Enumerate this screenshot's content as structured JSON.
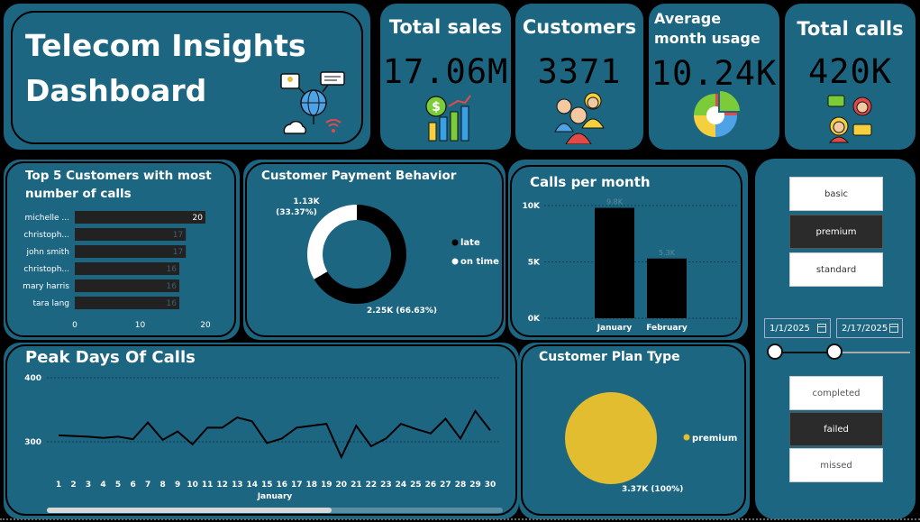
{
  "header": {
    "title_line1": "Telecom Insights",
    "title_line2": "Dashboard"
  },
  "kpis": [
    {
      "label": "Total sales",
      "value": "17.06M",
      "icon": "money-chart-icon"
    },
    {
      "label": "Customers",
      "value": "3371",
      "icon": "people-icon"
    },
    {
      "label": "Average month usage",
      "value": "10.24K",
      "icon": "pie-chart-icon"
    },
    {
      "label": "Total calls",
      "value": "420K",
      "icon": "phone-call-icon"
    }
  ],
  "top_customers": {
    "title": "Top 5 Customers with most number of calls"
  },
  "payment": {
    "title": "Customer Payment Behavior"
  },
  "calls_month": {
    "title": "Calls per month"
  },
  "peak_days": {
    "title": "Peak Days Of Calls"
  },
  "plan_type": {
    "title": "Customer Plan Type"
  },
  "slicers": {
    "plans": [
      {
        "label": "basic",
        "selected": false
      },
      {
        "label": "premium",
        "selected": true
      },
      {
        "label": "standard",
        "selected": false
      }
    ],
    "date_start": "1/1/2025",
    "date_end": "2/17/2025",
    "status": [
      {
        "label": "completed",
        "selected": false
      },
      {
        "label": "failed",
        "selected": true
      },
      {
        "label": "missed",
        "selected": false
      }
    ]
  },
  "colors": {
    "card": "#1d6682",
    "bar": "#222222",
    "premium": "#e2bd30"
  },
  "chart_data": [
    {
      "type": "bar",
      "orientation": "horizontal",
      "title": "Top 5 Customers with most number of calls",
      "categories": [
        "michelle ...",
        "christoph...",
        "john smith",
        "christoph...",
        "mary harris",
        "tara lang"
      ],
      "values": [
        20,
        17,
        17,
        16,
        16,
        16
      ],
      "data_labels": [
        "20",
        "17",
        "17",
        "16",
        "16",
        "16"
      ],
      "xlim": [
        0,
        20
      ],
      "xticks": [
        "0",
        "10",
        "20"
      ]
    },
    {
      "type": "pie",
      "style": "donut",
      "title": "Customer Payment Behavior",
      "categories": [
        "late",
        "on time"
      ],
      "values": [
        2250,
        1130
      ],
      "labels": [
        "2.25K (66.63%)",
        "1.13K (33.37%)"
      ],
      "colors": [
        "#000000",
        "#ffffff"
      ],
      "legend": "right"
    },
    {
      "type": "bar",
      "title": "Calls per month",
      "categories": [
        "January",
        "February"
      ],
      "values": [
        9800,
        5300
      ],
      "data_labels": [
        "9.8K",
        "5.3K"
      ],
      "ylim": [
        0,
        10000
      ],
      "yticks": [
        "0K",
        "5K",
        "10K"
      ],
      "grid": true
    },
    {
      "type": "line",
      "title": "Peak Days Of Calls",
      "x": [
        1,
        2,
        3,
        4,
        5,
        6,
        7,
        8,
        9,
        10,
        11,
        12,
        13,
        14,
        15,
        16,
        17,
        18,
        19,
        20,
        21,
        22,
        23,
        24,
        25,
        26,
        27,
        28,
        29,
        30
      ],
      "values": [
        310,
        309,
        308,
        306,
        308,
        304,
        330,
        303,
        316,
        296,
        322,
        322,
        338,
        332,
        298,
        305,
        322,
        325,
        328,
        276,
        325,
        293,
        305,
        328,
        320,
        313,
        336,
        305,
        348,
        318
      ],
      "ylim": [
        270,
        400
      ],
      "yticks": [
        "300",
        "400"
      ],
      "xlabel": "January"
    },
    {
      "type": "pie",
      "title": "Customer Plan Type",
      "categories": [
        "premium"
      ],
      "values": [
        3370
      ],
      "labels": [
        "3.37K (100%)"
      ],
      "colors": [
        "#e2bd30"
      ],
      "legend": "right"
    }
  ]
}
